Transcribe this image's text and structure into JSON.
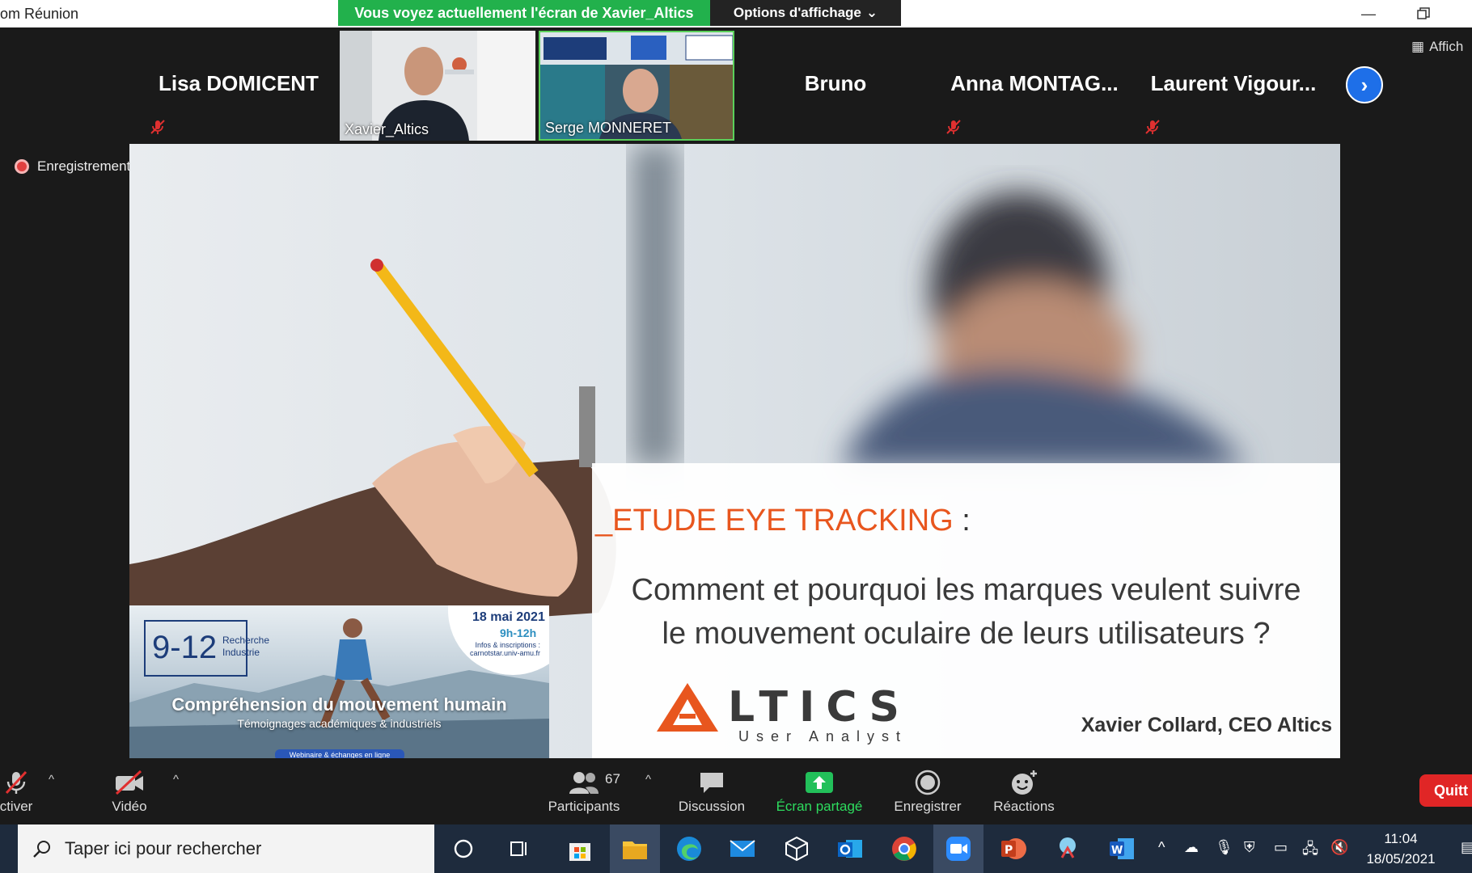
{
  "titlebar": {
    "title": "om Réunion",
    "share_banner": "Vous voyez actuellement l'écran de Xavier_Altics",
    "view_options": "Options d'affichage"
  },
  "gallery": {
    "participants": [
      {
        "name": "Lisa DOMICENT",
        "muted": true
      },
      {
        "name": "Xavier_Altics",
        "video": true
      },
      {
        "name": "Serge MONNERET",
        "video": true,
        "active_speaker": true
      },
      {
        "name": "Bruno",
        "muted": false
      },
      {
        "name": "Anna  MONTAG...",
        "muted": true
      },
      {
        "name": "Laurent  Vigour...",
        "muted": true
      }
    ],
    "affich_label": "Affich"
  },
  "recording": {
    "label": "Enregistrement"
  },
  "slide": {
    "heading_orange": "_ETUDE EYE TRACKING",
    "heading_rest": " :",
    "subtitle_line1": "Comment et pourquoi les marques veulent suivre",
    "subtitle_line2": "le mouvement oculaire de leurs utilisateurs ?",
    "logo_text": "LTICS",
    "logo_sub": "User Analyst",
    "presenter": "Xavier Collard, CEO Altics",
    "ad": {
      "number": "9-12",
      "tag1": "Recherche",
      "tag2": "Industrie",
      "date": "18 mai 2021",
      "hours": "9h-12h",
      "info1": "Infos & inscriptions :",
      "info2": "carnotstar.univ-amu.fr",
      "title": "Compréhension du mouvement humain",
      "subtitle": "Témoignages académiques & industriels",
      "strip": "Webinaire & échanges en ligne"
    }
  },
  "toolbar": {
    "mute_label": "ctiver",
    "video_label": "Vidéo",
    "participants_label": "Participants",
    "participants_count": "67",
    "chat_label": "Discussion",
    "share_label": "Écran partagé",
    "record_label": "Enregistrer",
    "reactions_label": "Réactions",
    "quit_label": "Quitt"
  },
  "taskbar": {
    "search_placeholder": "Taper ici pour rechercher",
    "time": "11:04",
    "date": "18/05/2021"
  },
  "colors": {
    "share_green": "#22b14c",
    "accent_blue": "#1e6fe8",
    "slide_orange": "#e8561e",
    "quit_red": "#e02626"
  }
}
